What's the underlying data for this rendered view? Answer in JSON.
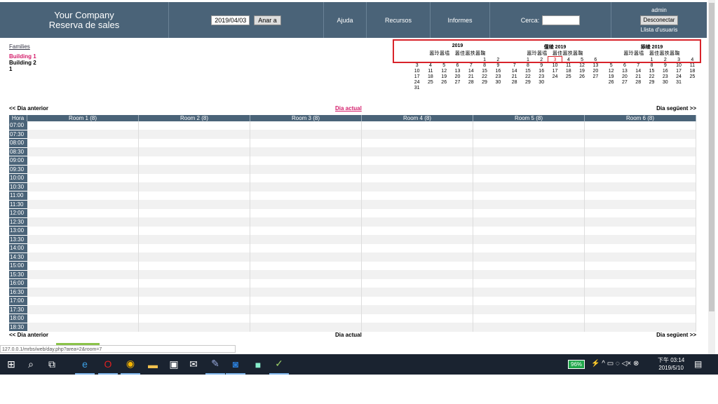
{
  "header": {
    "company": "Your Company",
    "app_name": "Reserva de sales",
    "date_value": "2019/04/03",
    "go_button": "Anar a",
    "help": "Ajuda",
    "resources": "Recursos",
    "reports": "Informes",
    "search_label": "Cerca:",
    "user": "admin",
    "logout": "Desconectar",
    "user_list": "Llista d'usuaris"
  },
  "areas": {
    "title": "Families",
    "items": [
      "Building 1",
      "Building 2",
      "1"
    ]
  },
  "mini_calendars": [
    {
      "title": "2019",
      "weekdays": "嚣玲嚣塭　嚣佳嚣抶嚣鞠",
      "weeks": [
        [
          "",
          "",
          "",
          "",
          "",
          "1",
          "2"
        ],
        [
          "3",
          "4",
          "5",
          "6",
          "7",
          "8",
          "9"
        ],
        [
          "10",
          "11",
          "12",
          "13",
          "14",
          "15",
          "16"
        ],
        [
          "17",
          "18",
          "19",
          "20",
          "21",
          "22",
          "23"
        ],
        [
          "24",
          "25",
          "26",
          "27",
          "28",
          "29",
          "30"
        ],
        [
          "31",
          "",
          "",
          "",
          "",
          "",
          ""
        ]
      ]
    },
    {
      "title": "僮绫 2019",
      "weekdays": "嚣玲嚣塭　嚣佳嚣抶嚣鞠",
      "weeks": [
        [
          "",
          "1",
          "2",
          "3",
          "4",
          "5",
          "6"
        ],
        [
          "7",
          "8",
          "9",
          "10",
          "11",
          "12",
          "13"
        ],
        [
          "14",
          "15",
          "16",
          "17",
          "18",
          "19",
          "20"
        ],
        [
          "21",
          "22",
          "23",
          "24",
          "25",
          "26",
          "27"
        ],
        [
          "28",
          "29",
          "30",
          "",
          "",
          "",
          ""
        ]
      ],
      "today": "3"
    },
    {
      "title": "掭绫 2019",
      "weekdays": "嚣玲嚣塭　嚣佳嚣抶嚣鞠",
      "weeks": [
        [
          "",
          "",
          "",
          "1",
          "2",
          "3",
          "4"
        ],
        [
          "5",
          "6",
          "7",
          "8",
          "9",
          "10",
          "11"
        ],
        [
          "12",
          "13",
          "14",
          "15",
          "16",
          "17",
          "18"
        ],
        [
          "19",
          "20",
          "21",
          "22",
          "23",
          "24",
          "25"
        ],
        [
          "26",
          "27",
          "28",
          "29",
          "30",
          "31",
          ""
        ]
      ]
    }
  ],
  "nav": {
    "prev": "<< Dia anterior",
    "today_link": "Dia actual",
    "next": "Dia següent >>"
  },
  "grid": {
    "time_header": "Hora",
    "rooms": [
      "Room 1 (8)",
      "Room 2 (8)",
      "Room 3 (8)",
      "Room 4 (8)",
      "Room 5 (8)",
      "Room 6 (8)"
    ],
    "times": [
      "07:00",
      "07:30",
      "08:00",
      "08:30",
      "09:00",
      "09:30",
      "10:00",
      "10:30",
      "11:00",
      "11:30",
      "12:00",
      "12:30",
      "13:00",
      "13:30",
      "14:00",
      "14:30",
      "15:00",
      "15:30",
      "16:00",
      "16:30",
      "17:00",
      "17:30",
      "18:00",
      "18:30"
    ]
  },
  "status_url": "127.0.0.1/mrbs/web/day.php?area=2&room=7",
  "taskbar": {
    "icons": [
      "windows-icon",
      "search-icon",
      "task-view-icon",
      "edge-icon",
      "opera-icon",
      "chrome-icon",
      "file-explorer-icon",
      "store-icon",
      "mail-icon",
      "paint-icon",
      "outlook-icon",
      "app-icon",
      "notepad-icon"
    ],
    "battery": "96%",
    "time": "下午 03:14",
    "date": "2019/5/10"
  },
  "colors": {
    "header_bg": "#4a6378",
    "accent_pink": "#d41c6a",
    "highlight_red": "#d8232a"
  }
}
